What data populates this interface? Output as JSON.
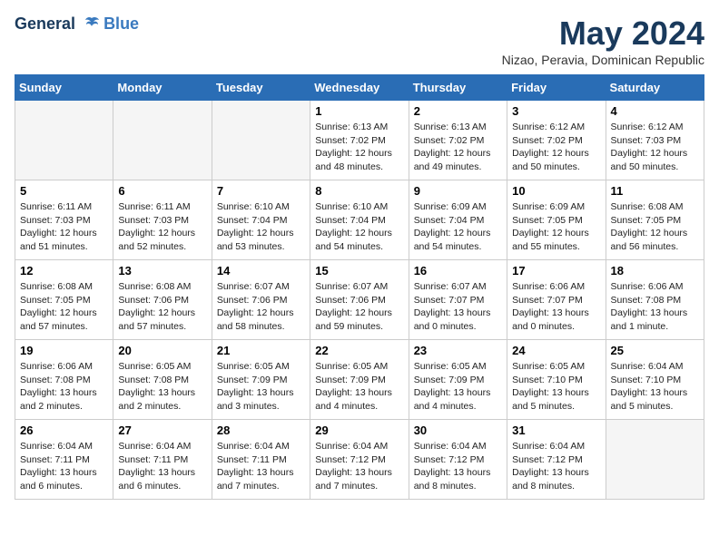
{
  "header": {
    "logo_line1": "General",
    "logo_line2": "Blue",
    "month_year": "May 2024",
    "location": "Nizao, Peravia, Dominican Republic"
  },
  "days_of_week": [
    "Sunday",
    "Monday",
    "Tuesday",
    "Wednesday",
    "Thursday",
    "Friday",
    "Saturday"
  ],
  "weeks": [
    {
      "days": [
        {
          "num": "",
          "info": ""
        },
        {
          "num": "",
          "info": ""
        },
        {
          "num": "",
          "info": ""
        },
        {
          "num": "1",
          "info": "Sunrise: 6:13 AM\nSunset: 7:02 PM\nDaylight: 12 hours\nand 48 minutes."
        },
        {
          "num": "2",
          "info": "Sunrise: 6:13 AM\nSunset: 7:02 PM\nDaylight: 12 hours\nand 49 minutes."
        },
        {
          "num": "3",
          "info": "Sunrise: 6:12 AM\nSunset: 7:02 PM\nDaylight: 12 hours\nand 50 minutes."
        },
        {
          "num": "4",
          "info": "Sunrise: 6:12 AM\nSunset: 7:03 PM\nDaylight: 12 hours\nand 50 minutes."
        }
      ]
    },
    {
      "days": [
        {
          "num": "5",
          "info": "Sunrise: 6:11 AM\nSunset: 7:03 PM\nDaylight: 12 hours\nand 51 minutes."
        },
        {
          "num": "6",
          "info": "Sunrise: 6:11 AM\nSunset: 7:03 PM\nDaylight: 12 hours\nand 52 minutes."
        },
        {
          "num": "7",
          "info": "Sunrise: 6:10 AM\nSunset: 7:04 PM\nDaylight: 12 hours\nand 53 minutes."
        },
        {
          "num": "8",
          "info": "Sunrise: 6:10 AM\nSunset: 7:04 PM\nDaylight: 12 hours\nand 54 minutes."
        },
        {
          "num": "9",
          "info": "Sunrise: 6:09 AM\nSunset: 7:04 PM\nDaylight: 12 hours\nand 54 minutes."
        },
        {
          "num": "10",
          "info": "Sunrise: 6:09 AM\nSunset: 7:05 PM\nDaylight: 12 hours\nand 55 minutes."
        },
        {
          "num": "11",
          "info": "Sunrise: 6:08 AM\nSunset: 7:05 PM\nDaylight: 12 hours\nand 56 minutes."
        }
      ]
    },
    {
      "days": [
        {
          "num": "12",
          "info": "Sunrise: 6:08 AM\nSunset: 7:05 PM\nDaylight: 12 hours\nand 57 minutes."
        },
        {
          "num": "13",
          "info": "Sunrise: 6:08 AM\nSunset: 7:06 PM\nDaylight: 12 hours\nand 57 minutes."
        },
        {
          "num": "14",
          "info": "Sunrise: 6:07 AM\nSunset: 7:06 PM\nDaylight: 12 hours\nand 58 minutes."
        },
        {
          "num": "15",
          "info": "Sunrise: 6:07 AM\nSunset: 7:06 PM\nDaylight: 12 hours\nand 59 minutes."
        },
        {
          "num": "16",
          "info": "Sunrise: 6:07 AM\nSunset: 7:07 PM\nDaylight: 13 hours\nand 0 minutes."
        },
        {
          "num": "17",
          "info": "Sunrise: 6:06 AM\nSunset: 7:07 PM\nDaylight: 13 hours\nand 0 minutes."
        },
        {
          "num": "18",
          "info": "Sunrise: 6:06 AM\nSunset: 7:08 PM\nDaylight: 13 hours\nand 1 minute."
        }
      ]
    },
    {
      "days": [
        {
          "num": "19",
          "info": "Sunrise: 6:06 AM\nSunset: 7:08 PM\nDaylight: 13 hours\nand 2 minutes."
        },
        {
          "num": "20",
          "info": "Sunrise: 6:05 AM\nSunset: 7:08 PM\nDaylight: 13 hours\nand 2 minutes."
        },
        {
          "num": "21",
          "info": "Sunrise: 6:05 AM\nSunset: 7:09 PM\nDaylight: 13 hours\nand 3 minutes."
        },
        {
          "num": "22",
          "info": "Sunrise: 6:05 AM\nSunset: 7:09 PM\nDaylight: 13 hours\nand 4 minutes."
        },
        {
          "num": "23",
          "info": "Sunrise: 6:05 AM\nSunset: 7:09 PM\nDaylight: 13 hours\nand 4 minutes."
        },
        {
          "num": "24",
          "info": "Sunrise: 6:05 AM\nSunset: 7:10 PM\nDaylight: 13 hours\nand 5 minutes."
        },
        {
          "num": "25",
          "info": "Sunrise: 6:04 AM\nSunset: 7:10 PM\nDaylight: 13 hours\nand 5 minutes."
        }
      ]
    },
    {
      "days": [
        {
          "num": "26",
          "info": "Sunrise: 6:04 AM\nSunset: 7:11 PM\nDaylight: 13 hours\nand 6 minutes."
        },
        {
          "num": "27",
          "info": "Sunrise: 6:04 AM\nSunset: 7:11 PM\nDaylight: 13 hours\nand 6 minutes."
        },
        {
          "num": "28",
          "info": "Sunrise: 6:04 AM\nSunset: 7:11 PM\nDaylight: 13 hours\nand 7 minutes."
        },
        {
          "num": "29",
          "info": "Sunrise: 6:04 AM\nSunset: 7:12 PM\nDaylight: 13 hours\nand 7 minutes."
        },
        {
          "num": "30",
          "info": "Sunrise: 6:04 AM\nSunset: 7:12 PM\nDaylight: 13 hours\nand 8 minutes."
        },
        {
          "num": "31",
          "info": "Sunrise: 6:04 AM\nSunset: 7:12 PM\nDaylight: 13 hours\nand 8 minutes."
        },
        {
          "num": "",
          "info": ""
        }
      ]
    }
  ]
}
